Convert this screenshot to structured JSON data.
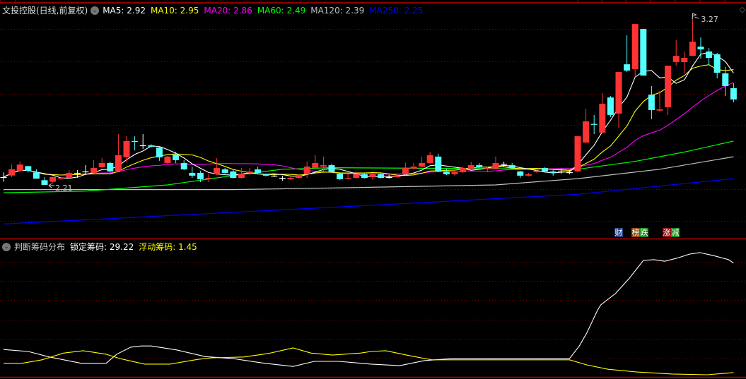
{
  "header": {
    "title": "文投控股(日线,前复权)",
    "ma_legend": [
      {
        "label": "MA5: 2.92",
        "color": "#ffffff"
      },
      {
        "label": "MA10: 2.95",
        "color": "#ffff00"
      },
      {
        "label": "MA20: 2.86",
        "color": "#ff00ff"
      },
      {
        "label": "MA60: 2.49",
        "color": "#00ff00"
      },
      {
        "label": "MA120: 2.39",
        "color": "#c0c0c0"
      },
      {
        "label": "MA250: 2.25",
        "color": "#0000ff"
      }
    ]
  },
  "indicator_header": {
    "title": "判断筹码分布",
    "items": [
      {
        "label": "锁定筹码: 29.22",
        "color": "#ffffff"
      },
      {
        "label": "浮动筹码: 1.45",
        "color": "#ffff00"
      }
    ]
  },
  "badges": [
    {
      "text": "财",
      "bg": "#1f3f7f"
    },
    {
      "text": "榜",
      "bg": "#8a4a10"
    },
    {
      "text": "跌",
      "bg": "#1a8a1a"
    },
    {
      "text": "涨",
      "bg": "#8a1010"
    },
    {
      "text": "减",
      "bg": "#1a8a1a"
    }
  ],
  "colors": {
    "up": "#ff3333",
    "down": "#54ffff",
    "flat": "#ffffff",
    "grid": "#8b0000",
    "border": "#c00000"
  },
  "chart_data": [
    {
      "type": "candlestick",
      "title": "文投控股(日线,前复权)",
      "ylim": [
        1.867,
        3.374
      ],
      "grid": true,
      "ohlc_fields": [
        "open",
        "high",
        "low",
        "close"
      ],
      "candles": [
        [
          2.26,
          2.29,
          2.23,
          2.26
        ],
        [
          2.27,
          2.34,
          2.26,
          2.31
        ],
        [
          2.3,
          2.36,
          2.29,
          2.34
        ],
        [
          2.33,
          2.33,
          2.29,
          2.3
        ],
        [
          2.29,
          2.31,
          2.25,
          2.25
        ],
        [
          2.24,
          2.26,
          2.21,
          2.21
        ],
        [
          2.23,
          2.26,
          2.22,
          2.26
        ],
        [
          2.251,
          2.26,
          2.242,
          2.255
        ],
        [
          2.255,
          2.305,
          2.251,
          2.287
        ],
        [
          2.287,
          2.305,
          2.255,
          2.287
        ],
        [
          2.296,
          2.336,
          2.278,
          2.296
        ],
        [
          2.287,
          2.368,
          2.282,
          2.318
        ],
        [
          2.323,
          2.382,
          2.318,
          2.35
        ],
        [
          2.35,
          2.359,
          2.291,
          2.296
        ],
        [
          2.3,
          2.535,
          2.296,
          2.4
        ],
        [
          2.386,
          2.521,
          2.354,
          2.49
        ],
        [
          2.49,
          2.521,
          2.431,
          2.485
        ],
        [
          2.463,
          2.535,
          2.44,
          2.463
        ],
        [
          2.463,
          2.47,
          2.449,
          2.454
        ],
        [
          2.449,
          2.458,
          2.364,
          2.386
        ],
        [
          2.35,
          2.395,
          2.345,
          2.391
        ],
        [
          2.404,
          2.422,
          2.35,
          2.368
        ],
        [
          2.35,
          2.368,
          2.305,
          2.309
        ],
        [
          2.287,
          2.327,
          2.255,
          2.269
        ],
        [
          2.287,
          2.3,
          2.228,
          2.246
        ],
        [
          2.251,
          2.278,
          2.228,
          2.255
        ],
        [
          2.278,
          2.382,
          2.273,
          2.318
        ],
        [
          2.309,
          2.318,
          2.282,
          2.287
        ],
        [
          2.296,
          2.305,
          2.251,
          2.255
        ],
        [
          2.255,
          2.318,
          2.251,
          2.282
        ],
        [
          2.287,
          2.318,
          2.273,
          2.296
        ],
        [
          2.309,
          2.327,
          2.282,
          2.287
        ],
        [
          2.278,
          2.282,
          2.264,
          2.269
        ],
        [
          2.269,
          2.278,
          2.26,
          2.269
        ],
        [
          2.255,
          2.269,
          2.237,
          2.255
        ],
        [
          2.246,
          2.26,
          2.242,
          2.255
        ],
        [
          2.255,
          2.278,
          2.251,
          2.273
        ],
        [
          2.278,
          2.359,
          2.255,
          2.327
        ],
        [
          2.318,
          2.4,
          2.314,
          2.35
        ],
        [
          2.327,
          2.391,
          2.296,
          2.336
        ],
        [
          2.336,
          2.345,
          2.287,
          2.291
        ],
        [
          2.282,
          2.287,
          2.242,
          2.246
        ],
        [
          2.251,
          2.278,
          2.246,
          2.255
        ],
        [
          2.255,
          2.296,
          2.251,
          2.278
        ],
        [
          2.278,
          2.287,
          2.251,
          2.255
        ],
        [
          2.26,
          2.282,
          2.242,
          2.278
        ],
        [
          2.278,
          2.287,
          2.251,
          2.255
        ],
        [
          2.26,
          2.273,
          2.251,
          2.26
        ],
        [
          2.26,
          2.273,
          2.255,
          2.269
        ],
        [
          2.278,
          2.35,
          2.273,
          2.318
        ],
        [
          2.314,
          2.35,
          2.309,
          2.327
        ],
        [
          2.327,
          2.391,
          2.323,
          2.35
        ],
        [
          2.35,
          2.422,
          2.345,
          2.4
        ],
        [
          2.391,
          2.409,
          2.291,
          2.296
        ],
        [
          2.296,
          2.314,
          2.273,
          2.278
        ],
        [
          2.278,
          2.305,
          2.269,
          2.291
        ],
        [
          2.291,
          2.327,
          2.287,
          2.318
        ],
        [
          2.314,
          2.359,
          2.309,
          2.336
        ],
        [
          2.336,
          2.35,
          2.318,
          2.323
        ],
        [
          2.314,
          2.327,
          2.291,
          2.318
        ],
        [
          2.314,
          2.391,
          2.309,
          2.35
        ],
        [
          2.345,
          2.359,
          2.323,
          2.345
        ],
        [
          2.336,
          2.35,
          2.314,
          2.318
        ],
        [
          2.296,
          2.3,
          2.255,
          2.269
        ],
        [
          2.269,
          2.287,
          2.264,
          2.278
        ],
        [
          2.291,
          2.305,
          2.287,
          2.3
        ],
        [
          2.318,
          2.323,
          2.291,
          2.296
        ],
        [
          2.296,
          2.305,
          2.269,
          2.287
        ],
        [
          2.296,
          2.314,
          2.282,
          2.296
        ],
        [
          2.291,
          2.305,
          2.278,
          2.291
        ],
        [
          2.296,
          2.521,
          2.29,
          2.521
        ],
        [
          2.481,
          2.697,
          2.478,
          2.616
        ],
        [
          2.6,
          2.657,
          2.535,
          2.594
        ],
        [
          2.544,
          2.796,
          2.544,
          2.729
        ],
        [
          2.769,
          2.778,
          2.643,
          2.657
        ],
        [
          2.666,
          2.932,
          2.575,
          2.932
        ],
        [
          2.981,
          3.166,
          2.932,
          2.941
        ],
        [
          2.95,
          3.238,
          2.9,
          3.238
        ],
        [
          3.207,
          3.207,
          2.909,
          2.909
        ],
        [
          2.787,
          2.842,
          2.63,
          2.688
        ],
        [
          2.685,
          2.81,
          2.679,
          2.693
        ],
        [
          2.706,
          2.972,
          2.657,
          2.972
        ],
        [
          2.995,
          3.135,
          2.972,
          3.035
        ],
        [
          2.995,
          3.063,
          2.923,
          3.022
        ],
        [
          3.035,
          3.27,
          3.035,
          3.126
        ],
        [
          3.094,
          3.153,
          3.017,
          3.076
        ],
        [
          3.063,
          3.085,
          2.977,
          3.022
        ],
        [
          3.045,
          3.054,
          2.891,
          2.927
        ],
        [
          2.923,
          2.963,
          2.778,
          2.842
        ],
        [
          2.828,
          2.86,
          2.738,
          2.756
        ]
      ],
      "computed_ma": [
        {
          "name": "MA5",
          "period": 5,
          "color": "#ffffff"
        },
        {
          "name": "MA10",
          "period": 10,
          "color": "#ffff00"
        },
        {
          "name": "MA20",
          "period": 20,
          "color": "#ff00ff"
        }
      ],
      "series": [
        {
          "name": "MA60",
          "color": "#00ff00",
          "points": [
            [
              0,
              2.16
            ],
            [
              10,
              2.17
            ],
            [
              20,
              2.21
            ],
            [
              28,
              2.27
            ],
            [
              34,
              2.31
            ],
            [
              40,
              2.32
            ],
            [
              70,
              2.31
            ],
            [
              77,
              2.36
            ],
            [
              83,
              2.42
            ],
            [
              89,
              2.49
            ]
          ]
        },
        {
          "name": "MA120",
          "color": "#c0c0c0",
          "points": [
            [
              0,
              2.18
            ],
            [
              28,
              2.18
            ],
            [
              40,
              2.19
            ],
            [
              60,
              2.21
            ],
            [
              70,
              2.25
            ],
            [
              80,
              2.31
            ],
            [
              89,
              2.39
            ]
          ]
        },
        {
          "name": "MA250",
          "color": "#0000ff",
          "points": [
            [
              0,
              1.96
            ],
            [
              45,
              2.08
            ],
            [
              70,
              2.15
            ],
            [
              89,
              2.25
            ]
          ]
        }
      ],
      "annotations": [
        {
          "text": "3.27",
          "index": 84,
          "value": 3.27,
          "kind": "high"
        },
        {
          "text": "2.21",
          "index": 5,
          "value": 2.21,
          "kind": "low"
        }
      ]
    },
    {
      "type": "line",
      "title": "判断筹码分布",
      "ylim": [
        0,
        35.1
      ],
      "grid": true,
      "series": [
        {
          "name": "锁定筹码",
          "color": "#ffffff",
          "points": [
            [
              0,
              7.3
            ],
            [
              3,
              6.8
            ],
            [
              5.6,
              5.4
            ],
            [
              9.5,
              3.8
            ],
            [
              12.5,
              3.8
            ],
            [
              13.8,
              6.1
            ],
            [
              15.5,
              7.9
            ],
            [
              16.8,
              8.2
            ],
            [
              18,
              8.2
            ],
            [
              21.1,
              7.2
            ],
            [
              24.6,
              5.5
            ],
            [
              28,
              5.0
            ],
            [
              31.5,
              3.9
            ],
            [
              35.3,
              3.0
            ],
            [
              37.9,
              4.3
            ],
            [
              40.9,
              4.3
            ],
            [
              44.8,
              3.6
            ],
            [
              48.3,
              3.2
            ],
            [
              51.3,
              4.5
            ],
            [
              54.7,
              5.0
            ],
            [
              69,
              5.0
            ],
            [
              70.2,
              8.2
            ],
            [
              71.1,
              11.5
            ],
            [
              72.4,
              17.2
            ],
            [
              72.8,
              18.6
            ],
            [
              74.6,
              21.5
            ],
            [
              76.3,
              25.4
            ],
            [
              78,
              29.9
            ],
            [
              79.3,
              30.1
            ],
            [
              80.6,
              29.7
            ],
            [
              82.3,
              30.6
            ],
            [
              83.6,
              31.5
            ],
            [
              84.9,
              31.9
            ],
            [
              86.6,
              31.1
            ],
            [
              88.4,
              30.1
            ],
            [
              89,
              29.22
            ]
          ]
        },
        {
          "name": "浮动筹码",
          "color": "#ffff00",
          "points": [
            [
              0,
              3.8
            ],
            [
              2.2,
              3.8
            ],
            [
              4.7,
              4.7
            ],
            [
              7.3,
              6.4
            ],
            [
              9.7,
              7.0
            ],
            [
              12.5,
              6.1
            ],
            [
              14.2,
              5.0
            ],
            [
              17.2,
              3.6
            ],
            [
              20.3,
              3.6
            ],
            [
              23.7,
              4.8
            ],
            [
              25.4,
              5.2
            ],
            [
              29.3,
              5.4
            ],
            [
              32.3,
              6.3
            ],
            [
              35.3,
              7.7
            ],
            [
              37.5,
              6.4
            ],
            [
              40.1,
              5.9
            ],
            [
              43.5,
              6.4
            ],
            [
              44.8,
              6.8
            ],
            [
              46.6,
              7.0
            ],
            [
              49.6,
              5.7
            ],
            [
              52.2,
              4.7
            ],
            [
              69,
              4.7
            ],
            [
              71.1,
              3.4
            ],
            [
              73.7,
              2.3
            ],
            [
              77.2,
              1.6
            ],
            [
              81.5,
              1.1
            ],
            [
              85.8,
              0.9
            ],
            [
              89,
              1.45
            ]
          ]
        }
      ]
    }
  ]
}
